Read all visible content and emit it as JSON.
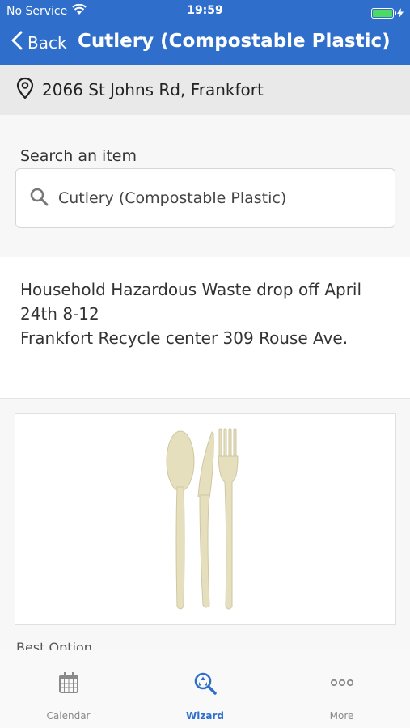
{
  "status": {
    "carrier": "No Service",
    "time": "19:59"
  },
  "nav": {
    "back_label": "Back",
    "title": "Cutlery (Compostable Plastic)"
  },
  "address": "2066 St Johns Rd, Frankfort",
  "search": {
    "label": "Search an item",
    "value": "Cutlery (Compostable Plastic)"
  },
  "notice": {
    "line1": "Household Hazardous Waste drop off April 24th 8-12",
    "line2": "Frankfort Recycle center 309 Rouse Ave."
  },
  "item": {
    "best_option_label": "Best Option"
  },
  "tabs": [
    {
      "label": "Calendar",
      "icon": "calendar-icon"
    },
    {
      "label": "Wizard",
      "icon": "wizard-icon"
    },
    {
      "label": "More",
      "icon": "more-icon"
    }
  ],
  "colors": {
    "primary": "#2f6fcb",
    "battery": "#4cd964",
    "cutlery": "#e6dfbd"
  }
}
